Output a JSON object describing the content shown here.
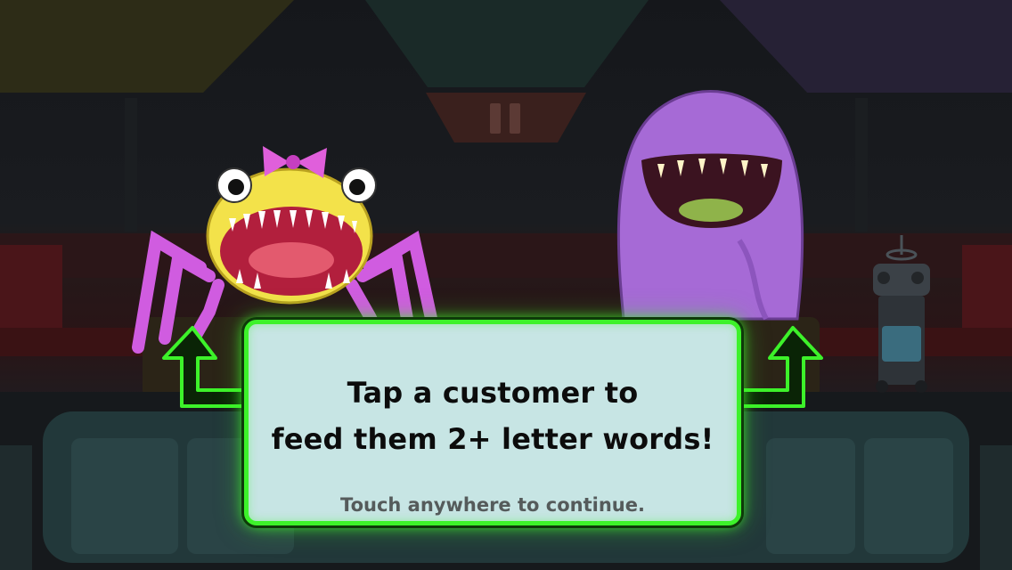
{
  "tutorial": {
    "line1": "Tap a customer to",
    "line2": "feed them 2+ letter words!",
    "hint": "Touch anywhere to continue."
  },
  "hud": {
    "pause_icon": "pause-icon"
  },
  "customers": [
    {
      "name": "yellow-spider-monster",
      "color": "#f3e24a"
    },
    {
      "name": "purple-blob-monster",
      "color": "#a66ad6"
    },
    {
      "name": "robot-cart",
      "color": "#3b4147"
    }
  ],
  "colors": {
    "accent_green": "#3df22a",
    "box_bg": "#c7e5e4"
  }
}
